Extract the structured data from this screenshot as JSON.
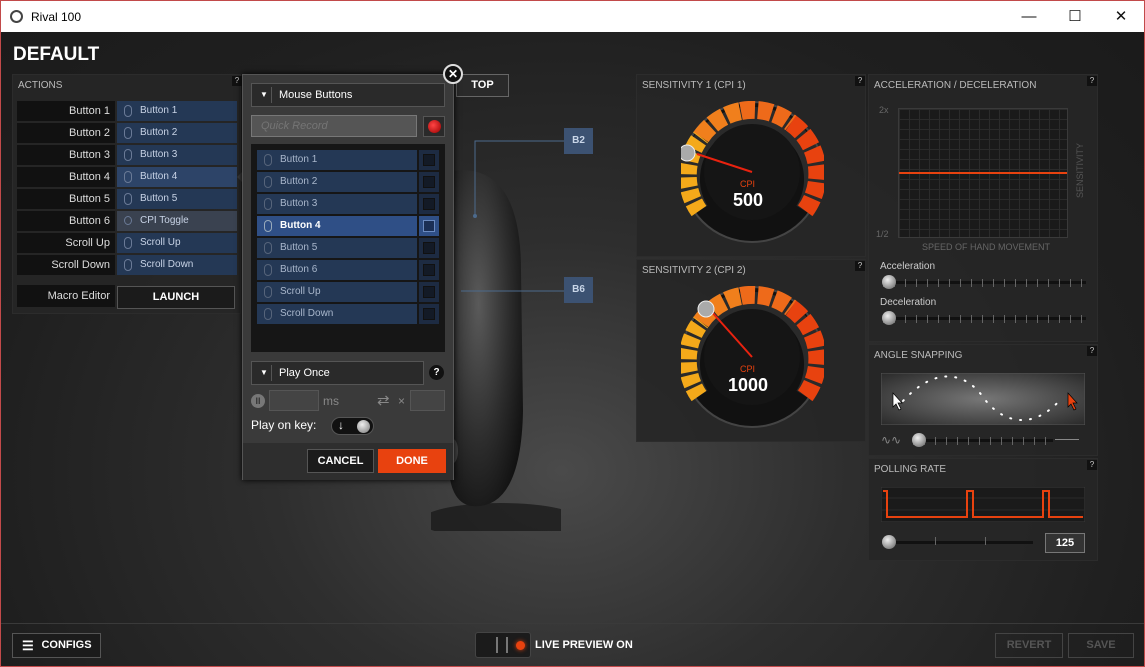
{
  "window": {
    "title": "Rival 100",
    "minimize": "—",
    "maximize": "☐",
    "close": "✕"
  },
  "page_title": "DEFAULT",
  "actions": {
    "header": "ACTIONS",
    "help": "?",
    "rows": [
      {
        "button": "Button 1",
        "action": "Button 1"
      },
      {
        "button": "Button 2",
        "action": "Button 2"
      },
      {
        "button": "Button 3",
        "action": "Button 3"
      },
      {
        "button": "Button 4",
        "action": "Button 4"
      },
      {
        "button": "Button 5",
        "action": "Button 5"
      },
      {
        "button": "Button 6",
        "action": "CPI Toggle"
      },
      {
        "button": "Scroll Up",
        "action": "Scroll Up"
      },
      {
        "button": "Scroll Down",
        "action": "Scroll Down"
      }
    ],
    "macro_editor_label": "Macro Editor",
    "launch_label": "LAUNCH"
  },
  "mouse_view": {
    "top_label": "TOP",
    "callouts": [
      "B2",
      "B6"
    ]
  },
  "dialog": {
    "category": "Mouse Buttons",
    "quick_record_placeholder": "Quick Record",
    "buttons": [
      "Button 1",
      "Button 2",
      "Button 3",
      "Button 4",
      "Button 5",
      "Button 6",
      "Scroll Up",
      "Scroll Down"
    ],
    "selected_index": 3,
    "play_mode": "Play Once",
    "help": "?",
    "delay_unit": "ms",
    "repeat_symbol": "×",
    "play_on_key_label": "Play on key:",
    "cancel_label": "CANCEL",
    "done_label": "DONE"
  },
  "sensitivity1": {
    "header": "SENSITIVITY 1 (CPI 1)",
    "unit": "CPI",
    "value": "500",
    "help": "?"
  },
  "sensitivity2": {
    "header": "SENSITIVITY 2 (CPI 2)",
    "unit": "CPI",
    "value": "1000",
    "help": "?"
  },
  "accel": {
    "header": "ACCELERATION / DECELERATION",
    "help": "?",
    "y_top": "2x",
    "y_bottom": "1/2",
    "x_label": "SPEED OF HAND MOVEMENT",
    "y_label": "SENSITIVITY",
    "acceleration_label": "Acceleration",
    "deceleration_label": "Deceleration"
  },
  "angle_snapping": {
    "header": "ANGLE SNAPPING",
    "help": "?"
  },
  "polling_rate": {
    "header": "POLLING RATE",
    "help": "?",
    "value": "125"
  },
  "bottom": {
    "configs_label": "CONFIGS",
    "live_preview_label": "LIVE PREVIEW ON",
    "revert_label": "REVERT",
    "save_label": "SAVE"
  },
  "colors": {
    "accent": "#e8420f",
    "selected": "#2f4f86",
    "button_blue": "#243855"
  }
}
